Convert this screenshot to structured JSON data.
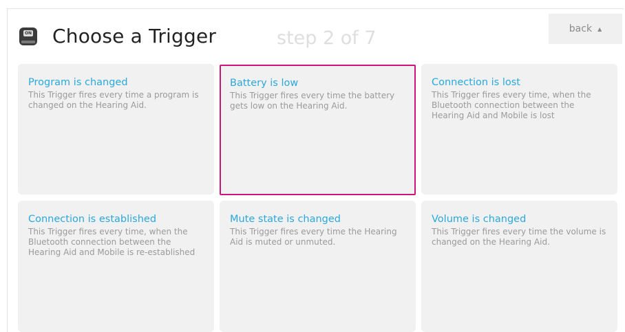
{
  "header": {
    "app_icon_label": "ON",
    "title": "Choose a Trigger",
    "step": "step 2 of 7"
  },
  "nav": {
    "back_label": "back"
  },
  "colors": {
    "title_link": "#2aa8dc",
    "selected_border": "#d1127d",
    "card_bg": "#f1f1f1"
  },
  "icons": {
    "app": "hearing-app-icon",
    "back_caret": "caret-down-icon"
  },
  "triggers": [
    {
      "title": "Program is changed",
      "description": "This Trigger fires every time a program is changed on the Hearing Aid."
    },
    {
      "title": "Battery is low",
      "description": "This Trigger fires every time the battery gets low on the Hearing Aid.",
      "selected": true
    },
    {
      "title": "Connection is lost",
      "description": "This Trigger fires every time, when the Bluetooth connection between the Hearing Aid and Mobile is lost"
    },
    {
      "title": "Connection is established",
      "description": "This Trigger fires every time, when the Bluetooth connection between the Hearing Aid and Mobile is re-established"
    },
    {
      "title": "Mute state is changed",
      "description": "This Trigger fires every time the Hearing Aid is muted or unmuted."
    },
    {
      "title": "Volume is changed",
      "description": "This Trigger fires every time the volume is changed on the Hearing Aid."
    }
  ]
}
